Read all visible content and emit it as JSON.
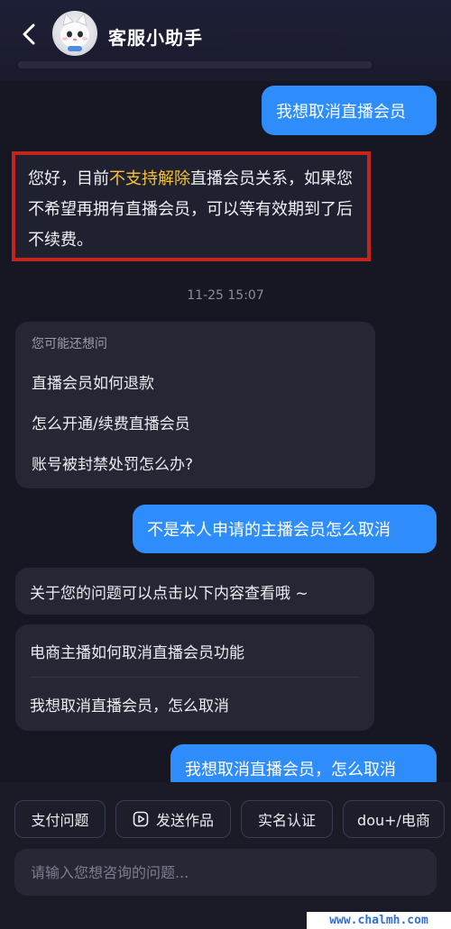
{
  "header": {
    "title": "客服小助手"
  },
  "messages": {
    "user_1": "我想取消直播会员",
    "answer": {
      "prefix": "您好，目前",
      "highlight": "不支持解除",
      "suffix": "直播会员关系，如果您不希望再拥有直播会员，可以等有效期到了后不续费。"
    },
    "timestamp": "11-25 15:07",
    "suggestions": {
      "title": "您可能还想问",
      "items": [
        "直播会员如何退款",
        "怎么开通/续费直播会员",
        "账号被封禁处罚怎么办?"
      ]
    },
    "user_2": "不是本人申请的主播会员怎么取消",
    "reply": "关于您的问题可以点击以下内容查看哦 ~",
    "links": [
      "电商主播如何取消直播会员功能",
      "我想取消直播会员，怎么取消"
    ],
    "user_3": "我想取消直播会员，怎么取消"
  },
  "quick_actions": [
    "支付问题",
    "发送作品",
    "实名认证",
    "dou+/电商"
  ],
  "input": {
    "placeholder": "请输入您想咨询的问题..."
  },
  "watermark": "www.chalmh.com",
  "colors": {
    "user_bubble": "#2f8dfb",
    "highlight": "#f7c335",
    "annotation_box": "#c4251a"
  }
}
